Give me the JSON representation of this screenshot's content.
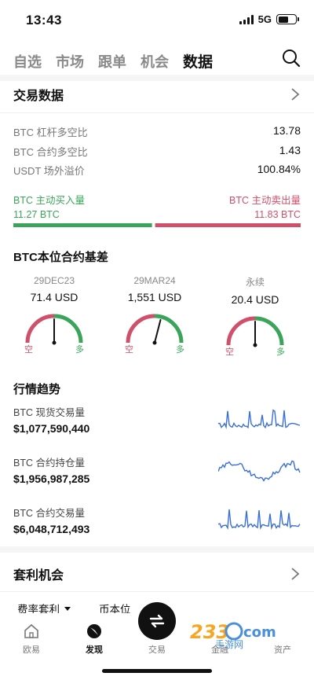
{
  "status_bar": {
    "time": "13:43",
    "network": "5G"
  },
  "top_tabs": [
    "自选",
    "市场",
    "跟单",
    "机会",
    "数据"
  ],
  "active_tab_index": 4,
  "trading_data": {
    "title": "交易数据",
    "stats": [
      {
        "label": "BTC 杠杆多空比",
        "value": "13.78"
      },
      {
        "label": "BTC 合约多空比",
        "value": "1.43"
      },
      {
        "label": "USDT 场外溢价",
        "value": "100.84%"
      }
    ],
    "buy": {
      "label": "BTC 主动买入量",
      "value": "11.27 BTC"
    },
    "sell": {
      "label": "BTC 主动卖出量",
      "value": "11.83 BTC"
    },
    "buy_ratio": 0.488,
    "colors": {
      "buy": "#3aa55a",
      "sell": "#d0506a"
    }
  },
  "basis": {
    "title": "BTC本位合约基差",
    "gauges": [
      {
        "label": "29DEC23",
        "value": "71.4 USD",
        "needle_ratio": 0.5,
        "neg": "空",
        "pos": "多"
      },
      {
        "label": "29MAR24",
        "value": "1,551 USD",
        "needle_ratio": 0.58,
        "neg": "空",
        "pos": "多"
      },
      {
        "label": "永续",
        "value": "20.4 USD",
        "needle_ratio": 0.5,
        "neg": "空",
        "pos": "多"
      }
    ]
  },
  "trends": {
    "title": "行情趋势",
    "items": [
      {
        "label": "BTC 现货交易量",
        "value": "$1,077,590,440"
      },
      {
        "label": "BTC 合约持仓量",
        "value": "$1,956,987,285"
      },
      {
        "label": "BTC 合约交易量",
        "value": "$6,048,712,493"
      }
    ],
    "line_color": "#3a6fd8"
  },
  "arbitrage": {
    "title": "套利机会",
    "filters": [
      {
        "label": "费率套利",
        "dropdown": true
      },
      {
        "label": "币本位",
        "dropdown": false
      }
    ]
  },
  "bottom_nav": {
    "items": [
      {
        "label": "欧易",
        "icon": "home-icon"
      },
      {
        "label": "发现",
        "icon": "discover-icon"
      },
      {
        "label": "交易",
        "icon": "swap-icon"
      },
      {
        "label": "金融",
        "icon": "finance-icon"
      },
      {
        "label": "资产",
        "icon": "assets-icon"
      }
    ]
  },
  "watermark": {
    "text": "2339com 手游网"
  }
}
